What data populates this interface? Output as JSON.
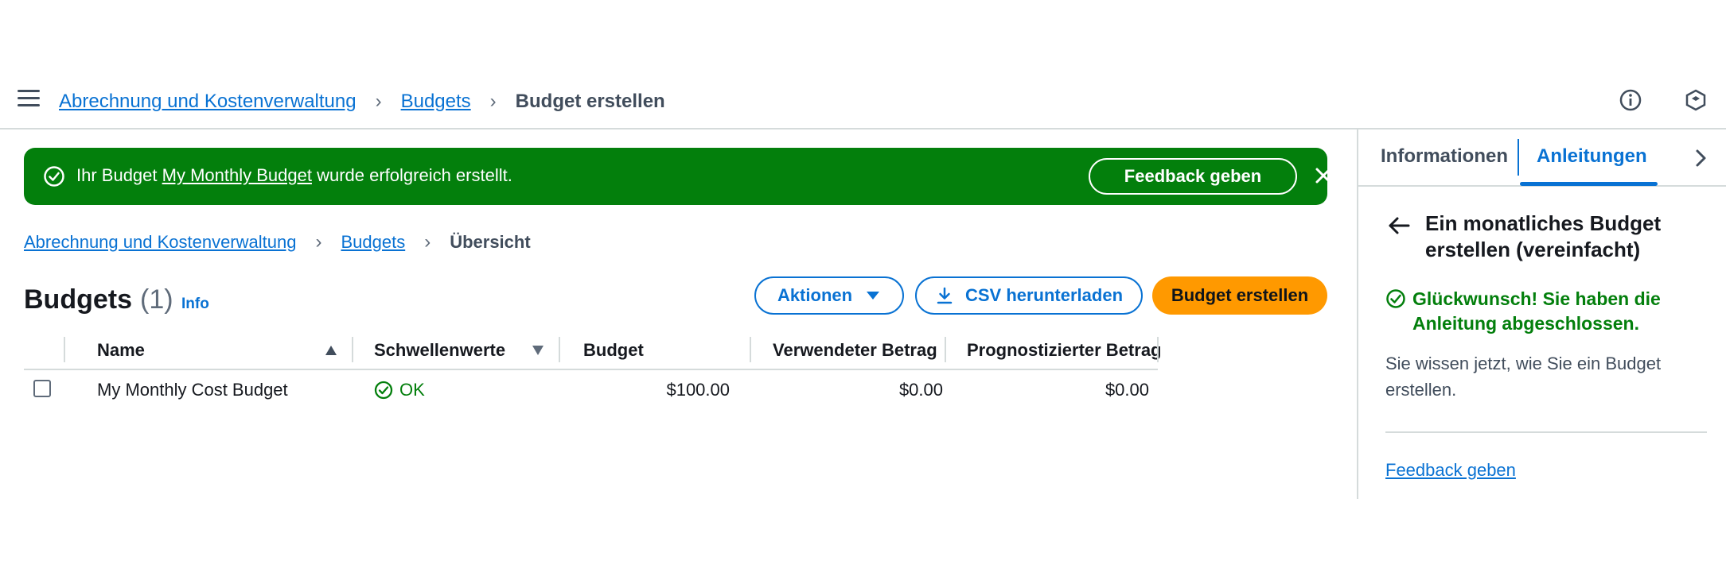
{
  "topbar": {
    "menu_icon": "hamburger-menu-icon",
    "breadcrumb": [
      {
        "label": "Abrechnung und Kostenverwaltung"
      },
      {
        "label": "Budgets"
      }
    ],
    "current": "Budget erstellen",
    "info_icon": "info-circle-icon",
    "settings_icon": "hexagon-icon"
  },
  "flash": {
    "message_prefix": "Ihr Budget ",
    "budget_link": "My Monthly Budget",
    "message_suffix": " wurde erfolgreich erstellt.",
    "feedback_button": "Feedback geben",
    "background": "#037f0c"
  },
  "breadcrumb": {
    "items": [
      {
        "label": "Abrechnung und Kostenverwaltung"
      },
      {
        "label": "Budgets"
      }
    ],
    "current": "Übersicht"
  },
  "header": {
    "title": "Budgets",
    "count": "(1)",
    "info": "Info",
    "actions_button": "Aktionen",
    "csv_button": "CSV herunterladen",
    "create_button": "Budget erstellen",
    "accent": "#ff9900"
  },
  "table": {
    "columns": [
      "Name",
      "Schwellenwerte",
      "Budget",
      "Verwendeter Betrag",
      "Prognostizierter Betrag"
    ],
    "rows": [
      {
        "name": "My Monthly Cost Budget",
        "status": "OK",
        "budget": "$100.00",
        "used": "$0.00",
        "forecast": "$0.00"
      }
    ]
  },
  "panel": {
    "tabs": [
      "Informationen",
      "Anleitungen"
    ],
    "active_tab": "Anleitungen",
    "guide_title": "Ein monatliches Budget erstellen (vereinfacht)",
    "congrats": "Glückwunsch! Sie haben die Anleitung abgeschlossen.",
    "description": "Sie wissen jetzt, wie Sie ein Budget erstellen.",
    "feedback_link": "Feedback geben",
    "success_color": "#037f0c"
  }
}
